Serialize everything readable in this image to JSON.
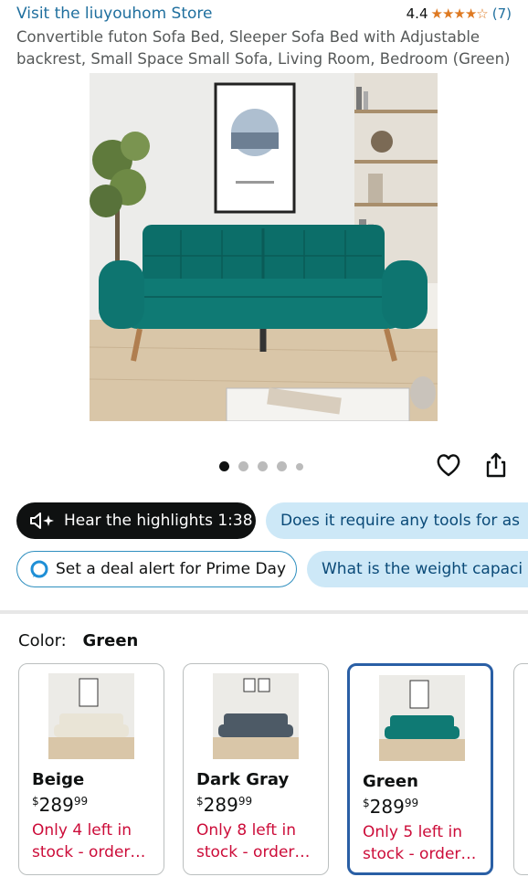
{
  "store": {
    "link": "Visit the liuyouhom Store",
    "rating": "4.4",
    "stars": "★★★★☆",
    "count": "(7)"
  },
  "product": {
    "title": "Convertible futon Sofa Bed, Sleeper Sofa Bed with Adjustable backrest, Small Space Small Sofa, Living Room, Bedroom (Green)"
  },
  "gallery": {
    "total_images": 5,
    "active_index": 0
  },
  "actions": {
    "heart_icon": "heart-icon",
    "share_icon": "share-icon"
  },
  "chips": {
    "hear": "Hear the highlights 1:38",
    "q1": "Does it require any tools for as",
    "deal": "Set a deal alert for Prime Day",
    "q2": "What is the weight capaci"
  },
  "color": {
    "label": "Color:",
    "value": "Green"
  },
  "variants": [
    {
      "name": "Beige",
      "currency": "$",
      "price_main": "289",
      "price_cents": "99",
      "stock": "Only 4 left in stock - order…",
      "swatch": "#e9e4d6"
    },
    {
      "name": "Dark Gray",
      "currency": "$",
      "price_main": "289",
      "price_cents": "99",
      "stock": "Only 8 left in stock - order…",
      "swatch": "#4d5a66"
    },
    {
      "name": "Green",
      "currency": "$",
      "price_main": "289",
      "price_cents": "99",
      "stock": "Only 5 left in stock - order…",
      "swatch": "#0f7a74"
    }
  ],
  "colors": {
    "link": "#1f6f9e",
    "star": "#de7921",
    "stock": "#cc0c39",
    "sofa": "#0f7a74",
    "selected_border": "#2a5fa5"
  }
}
